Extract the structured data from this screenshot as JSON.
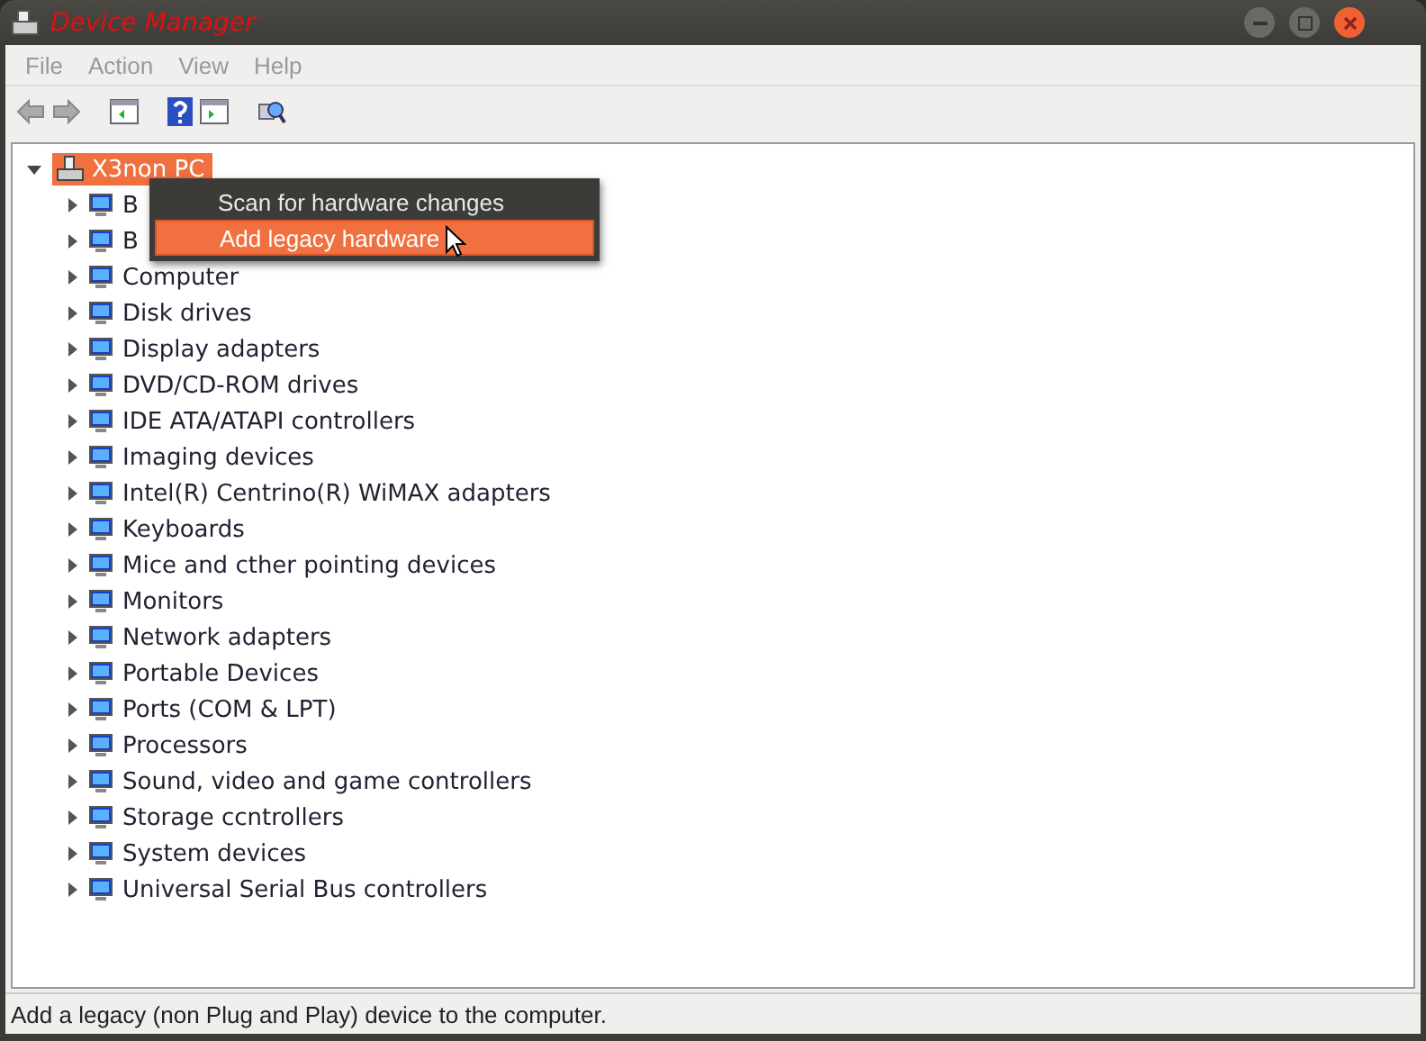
{
  "window": {
    "title": "Device Manager"
  },
  "menu_bar": [
    "File",
    "Action",
    "View",
    "Help"
  ],
  "tree": {
    "label": "X3non PC",
    "expanded": true,
    "selected": true,
    "children": [
      {
        "label": "B",
        "expanded": false
      },
      {
        "label": "B",
        "expanded": false
      },
      {
        "label": "Computer",
        "expanded": false
      },
      {
        "label": "Disk drives",
        "expanded": false
      },
      {
        "label": "Display adapters",
        "expanded": false
      },
      {
        "label": "DVD/CD-ROM drives",
        "expanded": false
      },
      {
        "label": "IDE ATA/ATAPI controllers",
        "expanded": false
      },
      {
        "label": "Imaging devices",
        "expanded": false
      },
      {
        "label": "Intel(R) Centrino(R) WiMAX adapters",
        "expanded": false
      },
      {
        "label": "Keyboards",
        "expanded": false
      },
      {
        "label": "Mice and cther pointing devices",
        "expanded": false
      },
      {
        "label": "Monitors",
        "expanded": false
      },
      {
        "label": "Network adapters",
        "expanded": false
      },
      {
        "label": "Portable Devices",
        "expanded": false
      },
      {
        "label": "Ports (COM & LPT)",
        "expanded": false
      },
      {
        "label": "Processors",
        "expanded": false
      },
      {
        "label": "Sound, video and game controllers",
        "expanded": false
      },
      {
        "label": "Storage ccntrollers",
        "expanded": false
      },
      {
        "label": "System devices",
        "expanded": false
      },
      {
        "label": "Universal Serial Bus controllers",
        "expanded": false
      }
    ]
  },
  "context_menu": [
    {
      "label": "Scan for hardware changes",
      "selected": false
    },
    {
      "label": "Add legacy hardware",
      "selected": true
    }
  ],
  "status_bar": "Add a legacy (non Plug and Play) device to the computer."
}
